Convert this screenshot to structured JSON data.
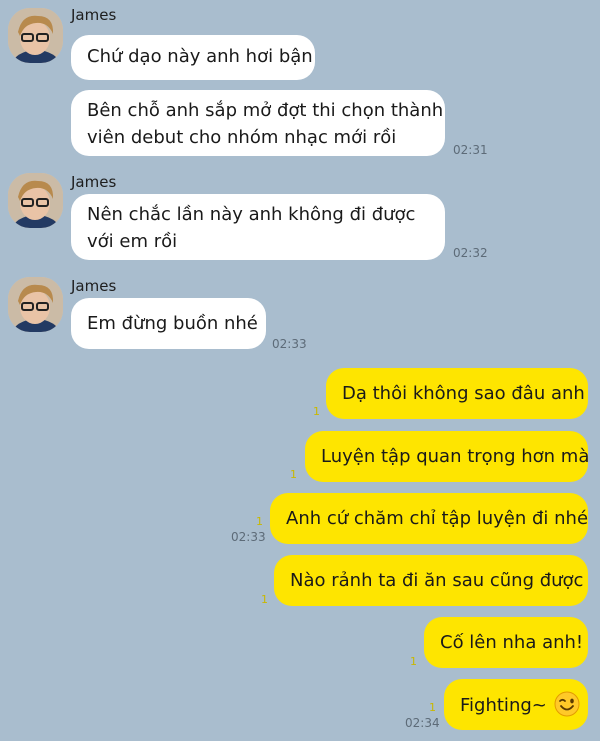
{
  "chat": {
    "sender_name": "James",
    "incoming": [
      {
        "text": "Chứ dạo này anh hơi bận"
      },
      {
        "text_line1": "Bên chỗ anh sắp mở đợt thi chọn thành",
        "text_line2": "viên debut cho nhóm nhạc mới rồi",
        "time": "02:31"
      },
      {
        "text_line1": "Nên chắc lần này anh không đi được",
        "text_line2": "với em rồi",
        "time": "02:32"
      },
      {
        "text": "Em đừng buồn nhé",
        "time": "02:33"
      }
    ],
    "outgoing": [
      {
        "text": "Dạ thôi không sao đâu anh",
        "unread": "1"
      },
      {
        "text": "Luyện tập quan trọng hơn mà",
        "unread": "1"
      },
      {
        "text": "Anh cứ chăm chỉ tập luyện đi nhé",
        "unread": "1",
        "time": "02:33"
      },
      {
        "text": "Nào rảnh ta đi ăn sau cũng được",
        "unread": "1"
      },
      {
        "text": "Cố lên nha anh!",
        "unread": "1"
      },
      {
        "text": "Fighting~",
        "emoji": "wink-emoji",
        "unread": "1",
        "time": "02:34"
      }
    ]
  },
  "colors": {
    "background": "#a9bdce",
    "incoming_bubble": "#ffffff",
    "outgoing_bubble": "#fee500",
    "unread_count": "#c9b800"
  }
}
